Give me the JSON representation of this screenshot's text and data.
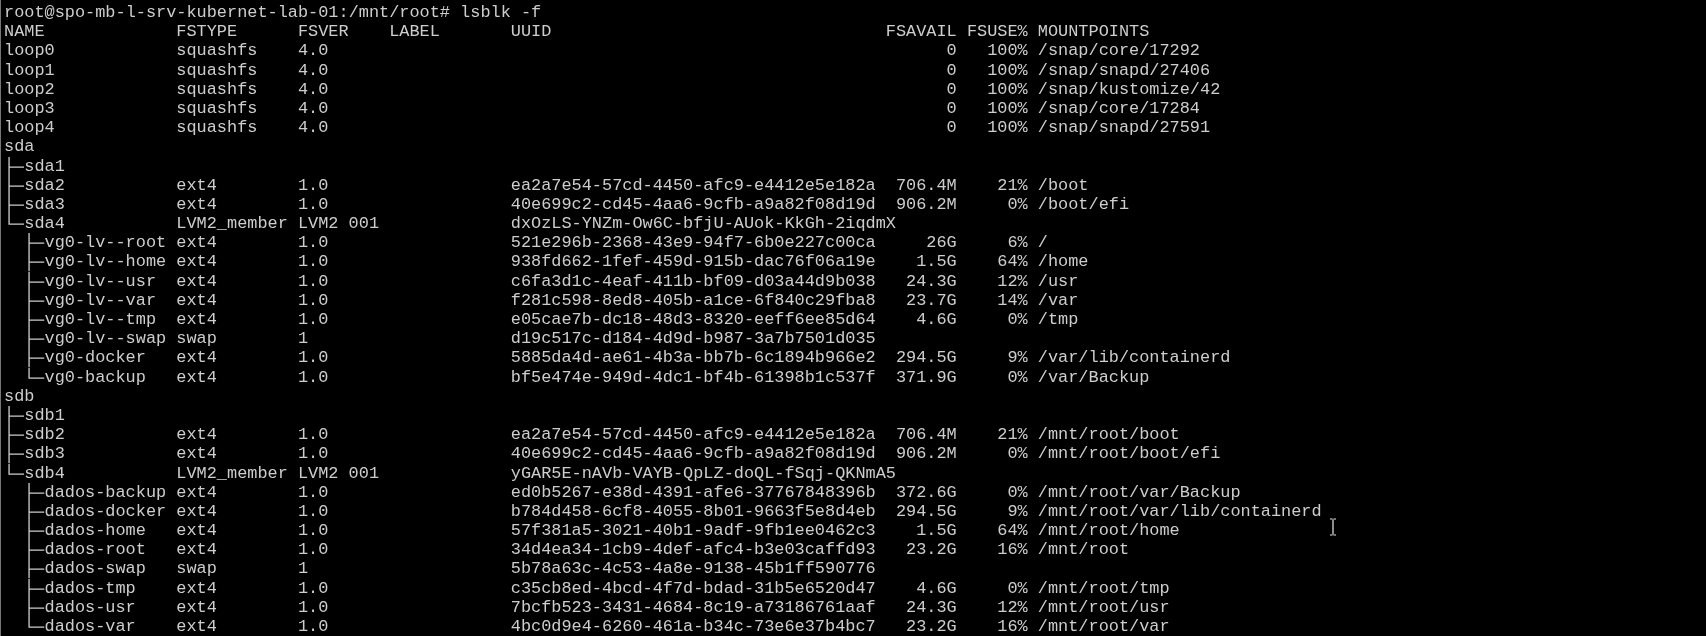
{
  "prompt": "root@spo-mb-l-srv-kubernet-lab-01:/mnt/root# lsblk -f",
  "columns": [
    "NAME",
    "FSTYPE",
    "FSVER",
    "LABEL",
    "UUID",
    "FSAVAIL",
    "FSUSE%",
    "MOUNTPOINTS"
  ],
  "devices": [
    {
      "name": "loop0",
      "fstype": "squashfs",
      "fsver": "4.0",
      "fsavail": "0",
      "fsuse": "100%",
      "mountpoints": "/snap/core/17292"
    },
    {
      "name": "loop1",
      "fstype": "squashfs",
      "fsver": "4.0",
      "fsavail": "0",
      "fsuse": "100%",
      "mountpoints": "/snap/snapd/27406"
    },
    {
      "name": "loop2",
      "fstype": "squashfs",
      "fsver": "4.0",
      "fsavail": "0",
      "fsuse": "100%",
      "mountpoints": "/snap/kustomize/42"
    },
    {
      "name": "loop3",
      "fstype": "squashfs",
      "fsver": "4.0",
      "fsavail": "0",
      "fsuse": "100%",
      "mountpoints": "/snap/core/17284"
    },
    {
      "name": "loop4",
      "fstype": "squashfs",
      "fsver": "4.0",
      "fsavail": "0",
      "fsuse": "100%",
      "mountpoints": "/snap/snapd/27591"
    },
    {
      "name": "sda",
      "children": [
        {
          "name": "sda1"
        },
        {
          "name": "sda2",
          "fstype": "ext4",
          "fsver": "1.0",
          "uuid": "ea2a7e54-57cd-4450-afc9-e4412e5e182a",
          "fsavail": "706.4M",
          "fsuse": "21%",
          "mountpoints": "/boot"
        },
        {
          "name": "sda3",
          "fstype": "ext4",
          "fsver": "1.0",
          "uuid": "40e699c2-cd45-4aa6-9cfb-a9a82f08d19d",
          "fsavail": "906.2M",
          "fsuse": "0%",
          "mountpoints": "/boot/efi"
        },
        {
          "name": "sda4",
          "fstype": "LVM2_member",
          "fsver": "LVM2 001",
          "uuid": "dxOzLS-YNZm-Ow6C-bfjU-AUok-KkGh-2iqdmX",
          "children": [
            {
              "name": "vg0-lv--root",
              "fstype": "ext4",
              "fsver": "1.0",
              "uuid": "521e296b-2368-43e9-94f7-6b0e227c00ca",
              "fsavail": "26G",
              "fsuse": "6%",
              "mountpoints": "/"
            },
            {
              "name": "vg0-lv--home",
              "fstype": "ext4",
              "fsver": "1.0",
              "uuid": "938fd662-1fef-459d-915b-dac76f06a19e",
              "fsavail": "1.5G",
              "fsuse": "64%",
              "mountpoints": "/home"
            },
            {
              "name": "vg0-lv--usr",
              "fstype": "ext4",
              "fsver": "1.0",
              "uuid": "c6fa3d1c-4eaf-411b-bf09-d03a44d9b038",
              "fsavail": "24.3G",
              "fsuse": "12%",
              "mountpoints": "/usr"
            },
            {
              "name": "vg0-lv--var",
              "fstype": "ext4",
              "fsver": "1.0",
              "uuid": "f281c598-8ed8-405b-a1ce-6f840c29fba8",
              "fsavail": "23.7G",
              "fsuse": "14%",
              "mountpoints": "/var"
            },
            {
              "name": "vg0-lv--tmp",
              "fstype": "ext4",
              "fsver": "1.0",
              "uuid": "e05cae7b-dc18-48d3-8320-eeff6ee85d64",
              "fsavail": "4.6G",
              "fsuse": "0%",
              "mountpoints": "/tmp"
            },
            {
              "name": "vg0-lv--swap",
              "fstype": "swap",
              "fsver": "1",
              "uuid": "d19c517c-d184-4d9d-b987-3a7b7501d035"
            },
            {
              "name": "vg0-docker",
              "fstype": "ext4",
              "fsver": "1.0",
              "uuid": "5885da4d-ae61-4b3a-bb7b-6c1894b966e2",
              "fsavail": "294.5G",
              "fsuse": "9%",
              "mountpoints": "/var/lib/containerd"
            },
            {
              "name": "vg0-backup",
              "fstype": "ext4",
              "fsver": "1.0",
              "uuid": "bf5e474e-949d-4dc1-bf4b-61398b1c537f",
              "fsavail": "371.9G",
              "fsuse": "0%",
              "mountpoints": "/var/Backup"
            }
          ]
        }
      ]
    },
    {
      "name": "sdb",
      "children": [
        {
          "name": "sdb1"
        },
        {
          "name": "sdb2",
          "fstype": "ext4",
          "fsver": "1.0",
          "uuid": "ea2a7e54-57cd-4450-afc9-e4412e5e182a",
          "fsavail": "706.4M",
          "fsuse": "21%",
          "mountpoints": "/mnt/root/boot"
        },
        {
          "name": "sdb3",
          "fstype": "ext4",
          "fsver": "1.0",
          "uuid": "40e699c2-cd45-4aa6-9cfb-a9a82f08d19d",
          "fsavail": "906.2M",
          "fsuse": "0%",
          "mountpoints": "/mnt/root/boot/efi"
        },
        {
          "name": "sdb4",
          "fstype": "LVM2_member",
          "fsver": "LVM2 001",
          "uuid": "yGAR5E-nAVb-VAYB-QpLZ-doQL-fSqj-QKNmA5",
          "children": [
            {
              "name": "dados-backup",
              "fstype": "ext4",
              "fsver": "1.0",
              "uuid": "ed0b5267-e38d-4391-afe6-37767848396b",
              "fsavail": "372.6G",
              "fsuse": "0%",
              "mountpoints": "/mnt/root/var/Backup"
            },
            {
              "name": "dados-docker",
              "fstype": "ext4",
              "fsver": "1.0",
              "uuid": "b784d458-6cf8-4055-8b01-9663f5e8d4eb",
              "fsavail": "294.5G",
              "fsuse": "9%",
              "mountpoints": "/mnt/root/var/lib/containerd"
            },
            {
              "name": "dados-home",
              "fstype": "ext4",
              "fsver": "1.0",
              "uuid": "57f381a5-3021-40b1-9adf-9fb1ee0462c3",
              "fsavail": "1.5G",
              "fsuse": "64%",
              "mountpoints": "/mnt/root/home"
            },
            {
              "name": "dados-root",
              "fstype": "ext4",
              "fsver": "1.0",
              "uuid": "34d4ea34-1cb9-4def-afc4-b3e03caffd93",
              "fsavail": "23.2G",
              "fsuse": "16%",
              "mountpoints": "/mnt/root"
            },
            {
              "name": "dados-swap",
              "fstype": "swap",
              "fsver": "1",
              "uuid": "5b78a63c-4c53-4a8e-9138-45b1ff590776"
            },
            {
              "name": "dados-tmp",
              "fstype": "ext4",
              "fsver": "1.0",
              "uuid": "c35cb8ed-4bcd-4f7d-bdad-31b5e6520d47",
              "fsavail": "4.6G",
              "fsuse": "0%",
              "mountpoints": "/mnt/root/tmp"
            },
            {
              "name": "dados-usr",
              "fstype": "ext4",
              "fsver": "1.0",
              "uuid": "7bcfb523-3431-4684-8c19-a73186761aaf",
              "fsavail": "24.3G",
              "fsuse": "12%",
              "mountpoints": "/mnt/root/usr"
            },
            {
              "name": "dados-var",
              "fstype": "ext4",
              "fsver": "1.0",
              "uuid": "4bc0d9e4-6260-461a-b34c-73e6e37b4bc7",
              "fsavail": "23.2G",
              "fsuse": "16%",
              "mountpoints": "/mnt/root/var"
            }
          ]
        }
      ]
    }
  ]
}
